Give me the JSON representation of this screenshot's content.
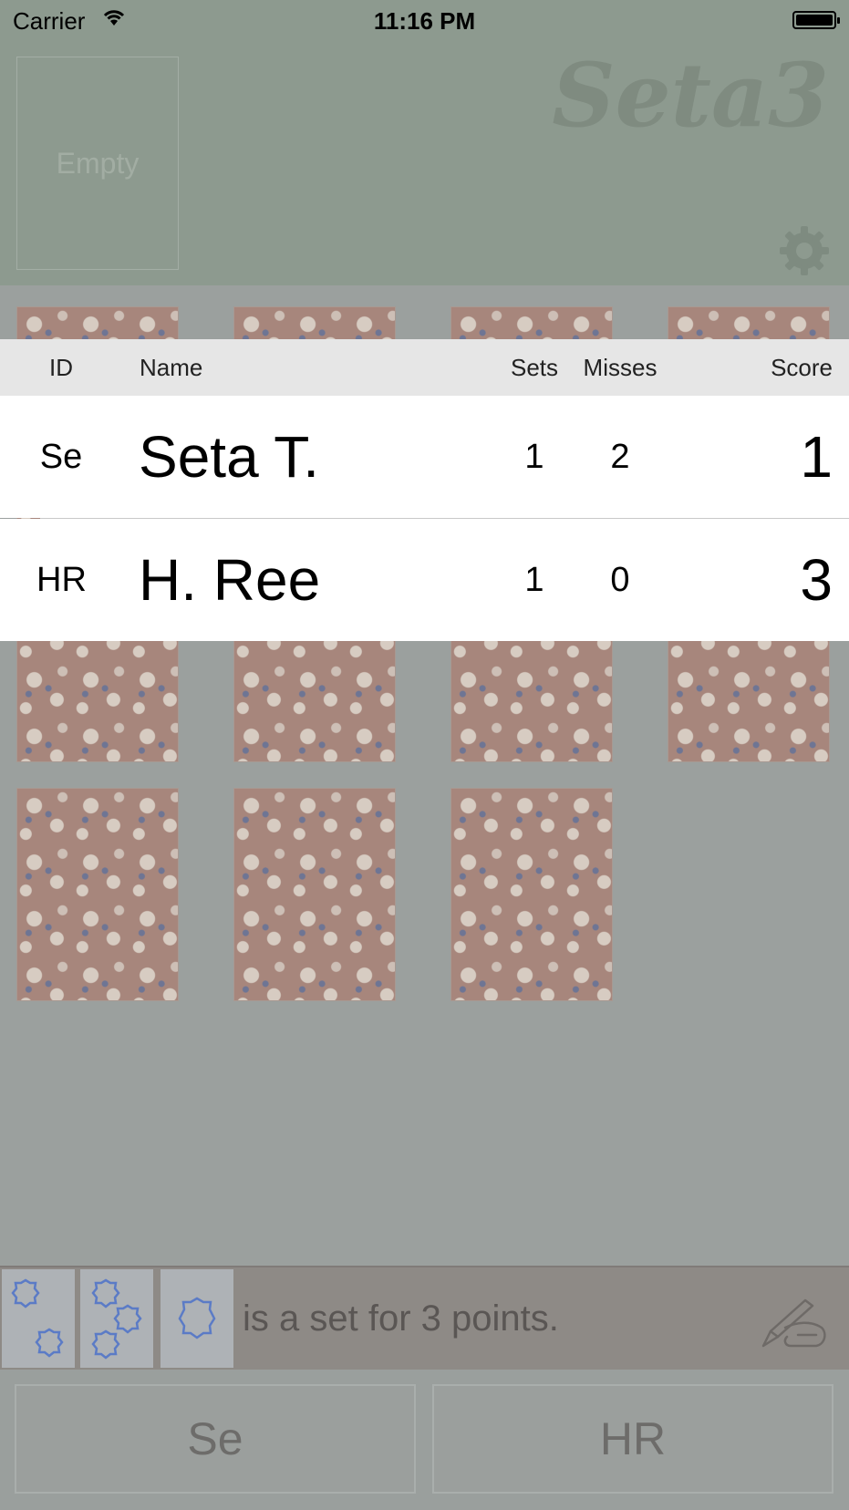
{
  "status": {
    "carrier": "Carrier",
    "time": "11:16 PM"
  },
  "header": {
    "empty_label": "Empty",
    "logo": "Seta3"
  },
  "scoreboard": {
    "columns": {
      "id": "ID",
      "name": "Name",
      "sets": "Sets",
      "misses": "Misses",
      "score": "Score"
    },
    "rows": [
      {
        "id": "Se",
        "name": "Seta T.",
        "sets": "1",
        "misses": "2",
        "score": "1"
      },
      {
        "id": "HR",
        "name": "H. Ree",
        "sets": "1",
        "misses": "0",
        "score": "3"
      }
    ]
  },
  "hint": {
    "text": "is a set for 3 points."
  },
  "players": {
    "left": "Se",
    "right": "HR"
  },
  "icons": {
    "wifi": "wifi-icon",
    "battery": "battery-icon",
    "gear": "gear-icon",
    "pen": "pen-hand-icon"
  },
  "colors": {
    "header": "#8d9a8f",
    "card": "#a7867c",
    "board": "#9ba09e",
    "hintbar": "#8e8a86"
  }
}
